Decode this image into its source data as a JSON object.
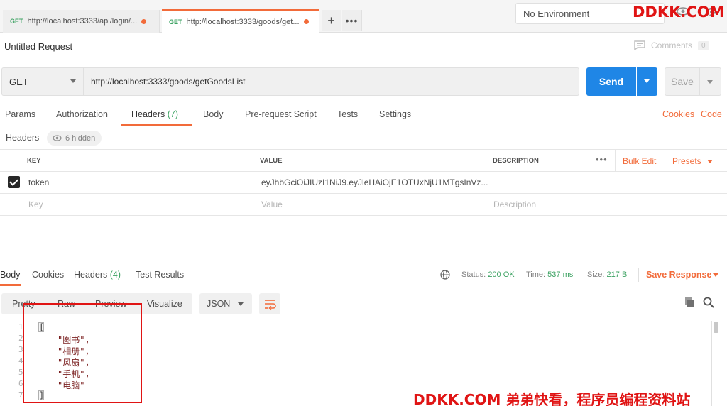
{
  "tabs": [
    {
      "method": "GET",
      "url": "http://localhost:3333/api/login/...",
      "unsaved": true
    },
    {
      "method": "GET",
      "url": "http://localhost:3333/goods/get...",
      "unsaved": true
    }
  ],
  "environment": {
    "label": "No Environment"
  },
  "watermark": {
    "top_right": "DDKK.COM",
    "bottom": "DDKK.COM 弟弟快看，程序员编程资料站"
  },
  "request": {
    "title": "Untitled Request",
    "comments_label": "Comments",
    "comments_count": "0",
    "method": "GET",
    "url": "http://localhost:3333/goods/getGoodsList",
    "send_label": "Send",
    "save_label": "Save"
  },
  "request_tabs": {
    "params": "Params",
    "authorization": "Authorization",
    "headers": "Headers",
    "headers_count": "(7)",
    "body": "Body",
    "prerequest": "Pre-request Script",
    "tests": "Tests",
    "settings": "Settings",
    "cookies": "Cookies",
    "code": "Code"
  },
  "headers_section": {
    "label": "Headers",
    "hidden_label": "6 hidden",
    "columns": {
      "key": "KEY",
      "value": "VALUE",
      "description": "DESCRIPTION"
    },
    "bulk_edit": "Bulk Edit",
    "presets": "Presets",
    "rows": [
      {
        "checked": true,
        "key": "token",
        "value": "eyJhbGciOiJIUzI1NiJ9.eyJleHAiOjE1OTUxNjU1MTgsInVz...",
        "description": ""
      }
    ],
    "placeholder_row": {
      "key": "Key",
      "value": "Value",
      "description": "Description"
    }
  },
  "response": {
    "tabs": {
      "body": "Body",
      "cookies": "Cookies",
      "headers": "Headers",
      "headers_count": "(4)",
      "test_results": "Test Results"
    },
    "status_label": "Status:",
    "status_value": "200 OK",
    "time_label": "Time:",
    "time_value": "537 ms",
    "size_label": "Size:",
    "size_value": "217 B",
    "save_response": "Save Response",
    "view_modes": [
      "Pretty",
      "Raw",
      "Preview",
      "Visualize"
    ],
    "format": "JSON",
    "line_numbers": [
      "1",
      "2",
      "3",
      "4",
      "5",
      "6",
      "7"
    ],
    "body_lines": [
      "[",
      "\"图书\",",
      "\"相册\",",
      "\"风扇\",",
      "\"手机\",",
      "\"电脑\"",
      "]"
    ]
  },
  "colors": {
    "accent": "#f26b3a",
    "send_blue": "#1f86e6",
    "green": "#3ca262",
    "watermark_red": "#e01414"
  }
}
